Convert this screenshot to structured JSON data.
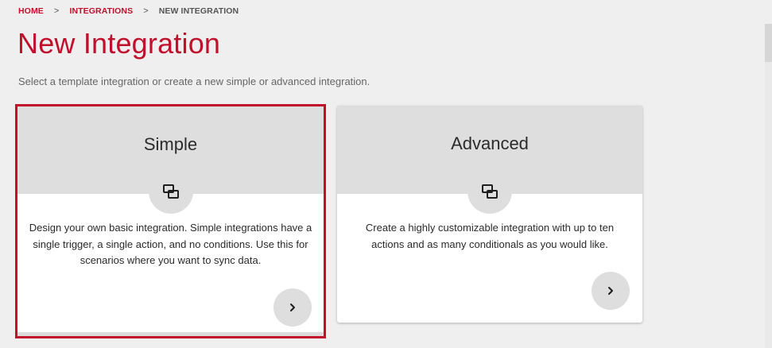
{
  "breadcrumb": {
    "home": "HOME",
    "integrations": "INTEGRATIONS",
    "current": "NEW INTEGRATION",
    "separator": ">"
  },
  "page": {
    "title": "New Integration",
    "subtitle": "Select a template integration or create a new simple or advanced integration."
  },
  "cards": {
    "simple": {
      "title": "Simple",
      "icon": "integration-link-icon",
      "description": "Design your own basic integration. Simple integrations have a single trigger, a single action, and no conditions. Use this for scenarios where you want to sync data.",
      "selected": true
    },
    "advanced": {
      "title": "Advanced",
      "icon": "integration-link-icon",
      "description": "Create a highly customizable integration with up to ten actions and as many conditionals as you would like.",
      "selected": false
    }
  },
  "colors": {
    "accent": "#c0102c",
    "background": "#efefef",
    "card_header": "#dedede"
  }
}
